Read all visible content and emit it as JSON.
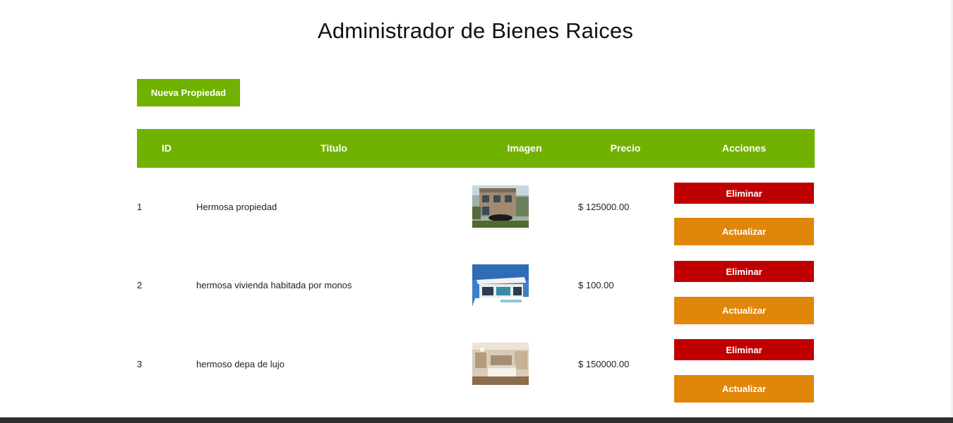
{
  "page": {
    "title": "Administrador de Bienes Raices",
    "new_button_label": "Nueva Propiedad"
  },
  "table": {
    "headers": [
      "ID",
      "Titulo",
      "Imagen",
      "Precio",
      "Acciones"
    ],
    "rows": [
      {
        "id": "1",
        "title": "Hermosa propiedad",
        "price": "$ 125000.00",
        "image": "house-thumbnail",
        "delete_label": "Eliminar",
        "update_label": "Actualizar"
      },
      {
        "id": "2",
        "title": "hermosa vivienda habitada por monos",
        "price": "$ 100.00",
        "image": "modern-house-thumbnail",
        "delete_label": "Eliminar",
        "update_label": "Actualizar"
      },
      {
        "id": "3",
        "title": "hermoso depa de lujo",
        "price": "$ 150000.00",
        "image": "bedroom-thumbnail",
        "delete_label": "Eliminar",
        "update_label": "Actualizar"
      }
    ]
  },
  "colors": {
    "accent_green": "#71b100",
    "delete_red": "#c00000",
    "update_orange": "#e0870a",
    "footer_dark": "#2e2e2e"
  }
}
